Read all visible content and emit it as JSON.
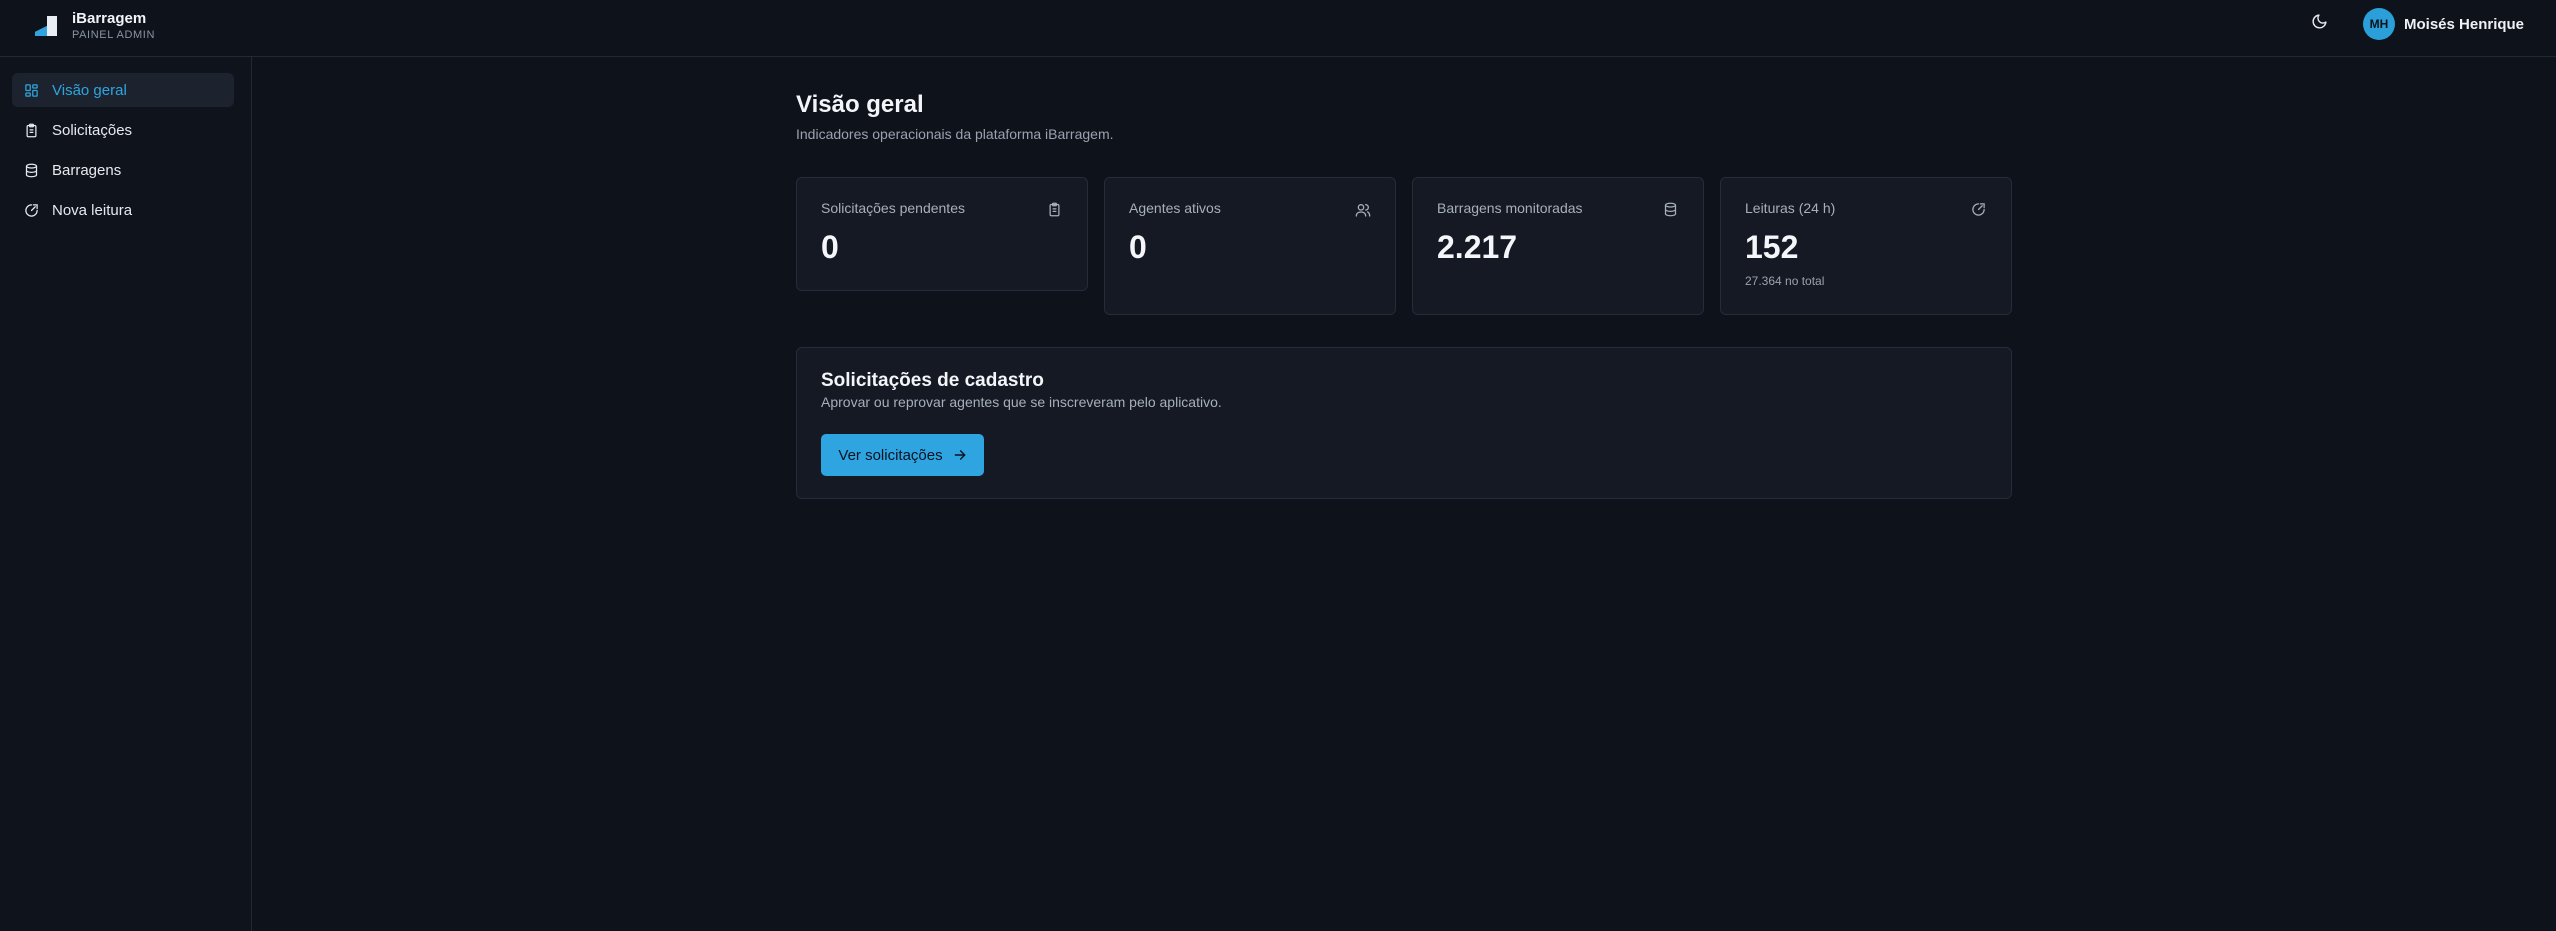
{
  "brand": {
    "name": "iBarragem",
    "subtitle": "PAINEL ADMIN",
    "logo_icon": "dam-logo-icon"
  },
  "header": {
    "theme_toggle_icon": "moon-icon",
    "user": {
      "initials": "MH",
      "name": "Moisés Henrique"
    }
  },
  "sidebar": {
    "items": [
      {
        "label": "Visão geral",
        "icon": "dashboard-grid-icon",
        "active": true
      },
      {
        "label": "Solicitações",
        "icon": "clipboard-icon",
        "active": false
      },
      {
        "label": "Barragens",
        "icon": "database-icon",
        "active": false
      },
      {
        "label": "Nova leitura",
        "icon": "gauge-icon",
        "active": false
      }
    ]
  },
  "main": {
    "title": "Visão geral",
    "subtitle": "Indicadores operacionais da plataforma iBarragem.",
    "cards": [
      {
        "label": "Solicitações pendentes",
        "value": "0",
        "icon": "clipboard-icon"
      },
      {
        "label": "Agentes ativos",
        "value": "0",
        "icon": "users-icon"
      },
      {
        "label": "Barragens monitoradas",
        "value": "2.217",
        "icon": "database-icon"
      },
      {
        "label": "Leituras (24 h)",
        "value": "152",
        "note": "27.364 no total",
        "icon": "gauge-icon"
      }
    ],
    "panel": {
      "title": "Solicitações de cadastro",
      "subtitle": "Aprovar ou reprovar agentes que se inscreveram pelo aplicativo.",
      "button_label": "Ver solicitações",
      "button_icon": "arrow-right-icon"
    }
  },
  "colors": {
    "background": "#0e121b",
    "surface": "#141923",
    "accent": "#2ea5e0",
    "border": "#262c38"
  }
}
